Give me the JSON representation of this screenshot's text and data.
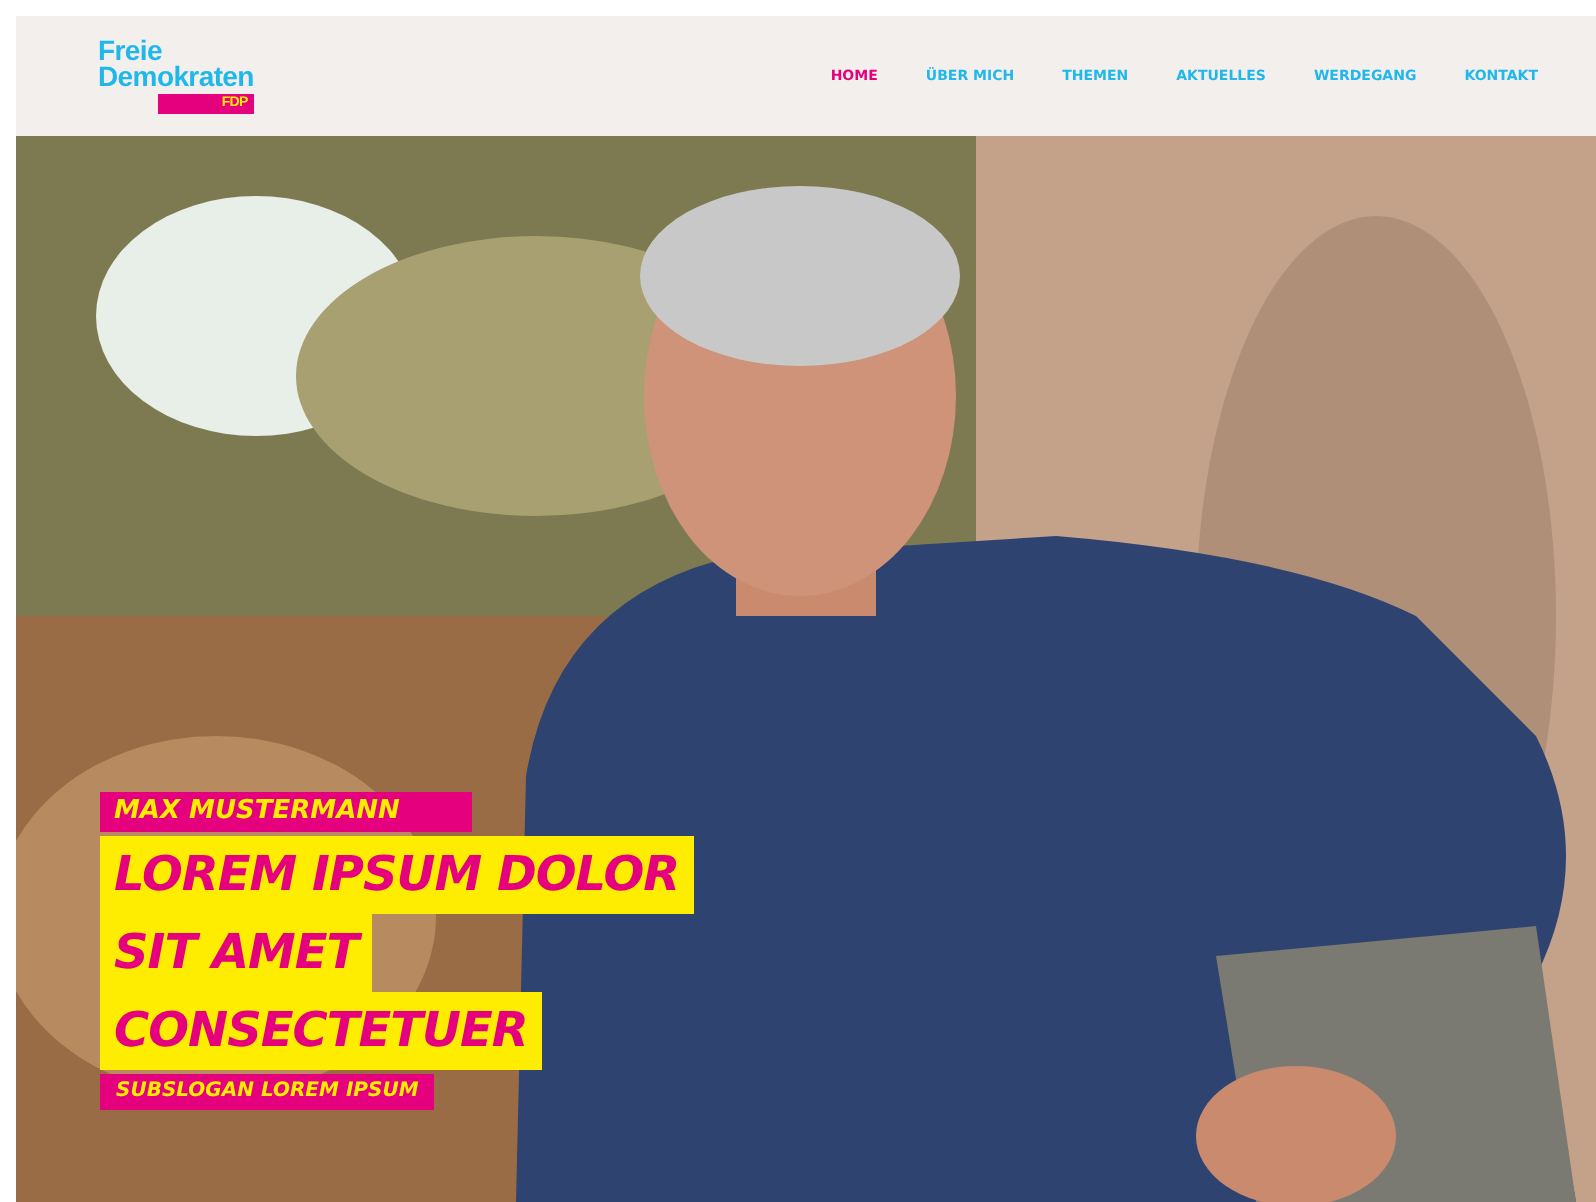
{
  "header": {
    "logo": {
      "line_1": "Freie",
      "line_2": "Demokraten",
      "tag": "FDP"
    },
    "nav": [
      {
        "label": "HOME",
        "selected": true
      },
      {
        "label": "ÜBER MICH",
        "selected": false
      },
      {
        "label": "THEMEN",
        "selected": false
      },
      {
        "label": "AKTUELLES",
        "selected": false
      },
      {
        "label": "WERDEGANG",
        "selected": false
      },
      {
        "label": "KONTAKT",
        "selected": false
      }
    ]
  },
  "hero": {
    "name": "MAX MUSTERMANN",
    "headline_lines": [
      "LOREM IPSUM DOLOR",
      "SIT AMET",
      "CONSECTETUER"
    ],
    "subslogan": "SUBSLOGAN LOREM IPSUM"
  }
}
